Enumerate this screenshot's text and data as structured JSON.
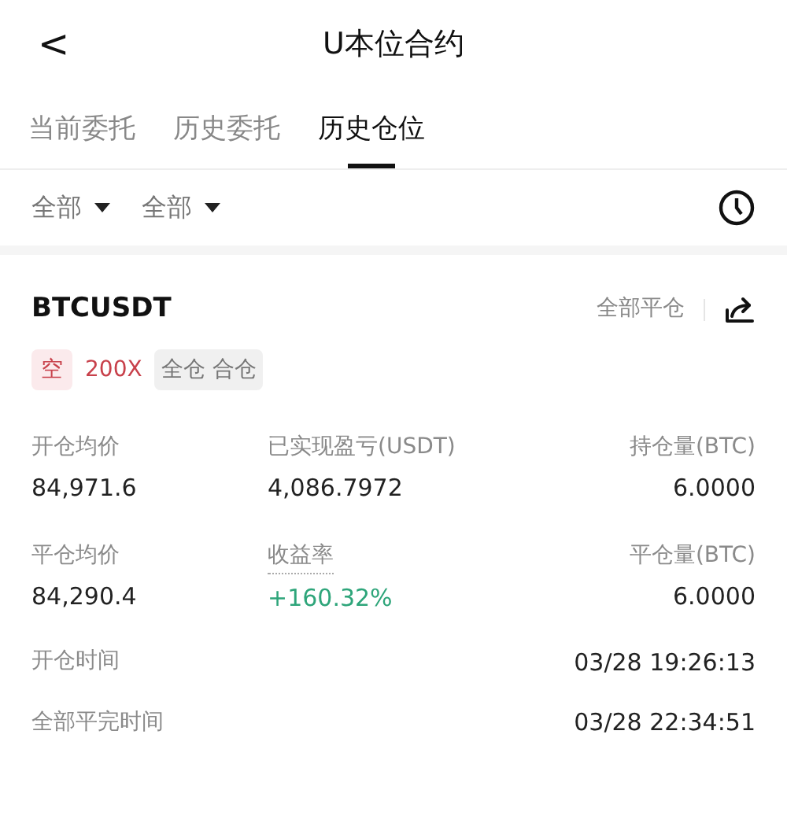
{
  "header": {
    "back": "<",
    "title": "U本位合约"
  },
  "tabs": [
    {
      "label": "当前委托",
      "selected": false
    },
    {
      "label": "历史委托",
      "selected": false
    },
    {
      "label": "历史仓位",
      "selected": true
    }
  ],
  "filters": [
    {
      "label": "全部"
    },
    {
      "label": "全部"
    }
  ],
  "position": {
    "symbol": "BTCUSDT",
    "close_all": "全部平仓",
    "tags": [
      {
        "kind": "side",
        "label": "空"
      },
      {
        "kind": "leverage",
        "label": "200X"
      },
      {
        "kind": "mode",
        "label": "全仓 合仓"
      }
    ],
    "stats": [
      [
        {
          "label": "开仓均价",
          "value": "84,971.6",
          "kind": "plain"
        },
        {
          "label": "已实现盈亏(USDT)",
          "value": "4,086.7972",
          "kind": "plain"
        },
        {
          "label": "持仓量(BTC)",
          "value": "6.0000",
          "kind": "plain"
        }
      ],
      [
        {
          "label": "平仓均价",
          "value": "84,290.4",
          "kind": "plain"
        },
        {
          "label": "收益率",
          "value": "+160.32%",
          "kind": "rate"
        },
        {
          "label": "平仓量(BTC)",
          "value": "6.0000",
          "kind": "plain"
        }
      ]
    ],
    "times": [
      {
        "label": "开仓时间",
        "value": "03/28 19:26:13"
      },
      {
        "label": "全部平完时间",
        "value": "03/28 22:34:51"
      }
    ]
  }
}
